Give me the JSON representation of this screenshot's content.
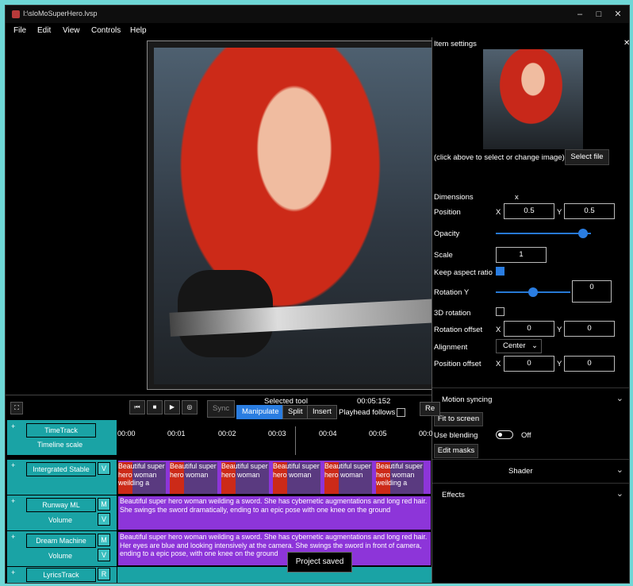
{
  "window": {
    "title": "I:\\sloMoSuperHero.lvsp",
    "controls": [
      "–",
      "□",
      "✕"
    ]
  },
  "menu": [
    "File",
    "Edit",
    "View",
    "Controls",
    "Help"
  ],
  "settings": {
    "header": "Item settings",
    "image_hint": "(click above to select or change image)",
    "select_file": "Select file",
    "dimensions_label": "Dimensions",
    "dimensions_x": "x",
    "position_label": "Position",
    "position_x_label": "X",
    "position_x": "0.5",
    "position_y_label": "Y",
    "position_y": "0.5",
    "opacity_label": "Opacity",
    "opacity_value": 0.92,
    "scale_label": "Scale",
    "scale_value": "1",
    "keep_aspect_label": "Keep aspect ratio",
    "keep_aspect": true,
    "rotation_y_label": "Rotation Y",
    "rotation_y_value": "0",
    "rotation_y_slider": 0.5,
    "rot3d_label": "3D rotation",
    "rot_offset_label": "Rotation offset",
    "rot_offset_x_label": "X",
    "rot_offset_x": "0",
    "rot_offset_y_label": "Y",
    "rot_offset_y": "0",
    "alignment_label": "Alignment",
    "alignment_value": "Center",
    "pos_offset_label": "Position offset",
    "pos_offset_x_label": "X",
    "pos_offset_x": "0",
    "pos_offset_y_label": "Y",
    "pos_offset_y": "0",
    "motion_syncing": "Motion syncing",
    "fit_to_screen": "Fit to screen",
    "use_blending_label": "Use blending",
    "use_blending_state": "Off",
    "edit_masks": "Edit masks",
    "shader": "Shader",
    "effects": "Effects"
  },
  "transport": {
    "sync": "Sync",
    "selected_tool_label": "Selected tool",
    "time": "00:05:152",
    "tools": [
      "Manipulate",
      "Split",
      "Insert"
    ],
    "active_tool": "Manipulate",
    "playhead_follows": "Playhead follows",
    "re_button": "Re"
  },
  "timeline": {
    "ruler": [
      "00:00",
      "00:01",
      "00:02",
      "00:03",
      "00:04",
      "00:05",
      "00:0"
    ],
    "tracks": [
      {
        "name": "TimeTrack",
        "sub": "Timeline scale",
        "letter": ""
      },
      {
        "name": "Intergrated Stable",
        "letter": "V"
      },
      {
        "name": "Runway ML",
        "sub": "Volume",
        "letter": "M",
        "sub_letter": "V"
      },
      {
        "name": "Dream Machine",
        "sub": "Volume",
        "letter": "M",
        "sub_letter": "V"
      },
      {
        "name": "LyricsTrack",
        "letter": "R"
      }
    ],
    "stable_clips": [
      "Beautiful super hero woman weilding a",
      "Beautiful super hero woman",
      "Beautiful super hero woman",
      "Beautiful super hero woman",
      "Beautiful super hero woman",
      "Beautiful super hero woman weilding a"
    ],
    "runway_text": "Beautiful super hero woman weilding a sword. She has cybernetic augmentations and long red hair. She swings the sword dramatically, ending to an epic pose with one knee on the ground",
    "dream_text": "Beautiful super hero woman weilding a sword. She has cybernetic augmentations and long red hair. Her eyes are blue and looking intensively at the camera. She swings the sword in front of camera, ending to a epic pose, with one knee on the ground",
    "toast": "Project saved"
  }
}
